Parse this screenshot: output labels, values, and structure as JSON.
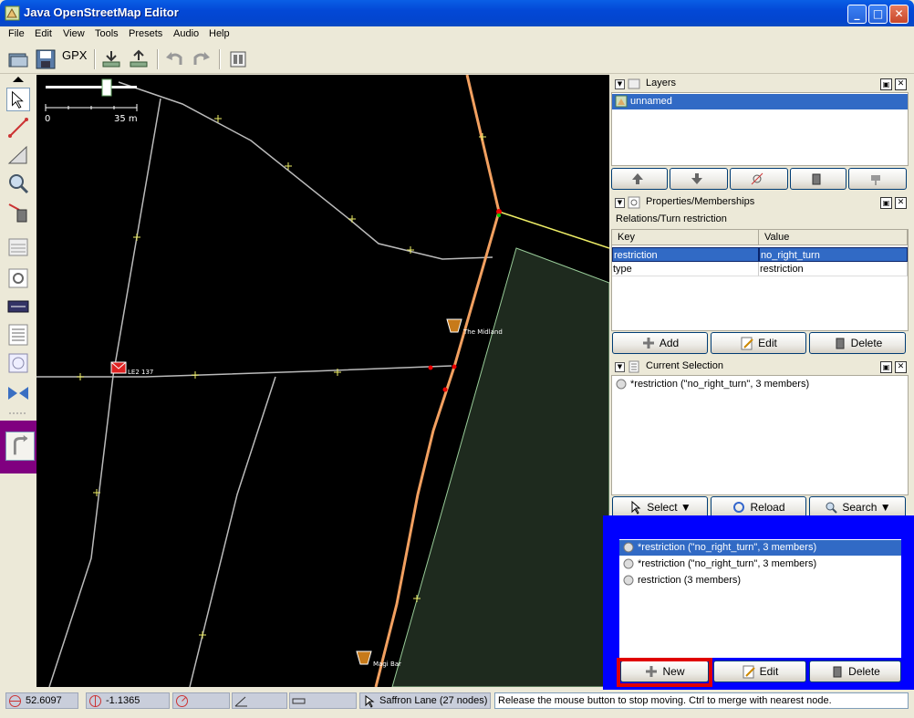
{
  "window": {
    "title": "Java OpenStreetMap Editor"
  },
  "menu": [
    "File",
    "Edit",
    "View",
    "Tools",
    "Presets",
    "Audio",
    "Help"
  ],
  "toolbar": {
    "gpx_label": "GPX"
  },
  "map": {
    "scale_min": "0",
    "scale_max": "35 m",
    "labels": {
      "postbox": "LE2 137",
      "pub1": "The Midland",
      "pub2": "Magi Bar"
    }
  },
  "layers": {
    "title": "Layers",
    "items": [
      {
        "label": "unnamed",
        "selected": true
      }
    ]
  },
  "properties": {
    "title": "Properties/Memberships",
    "subtitle": "Relations/Turn restriction",
    "columns": [
      "Key",
      "Value"
    ],
    "rows": [
      {
        "key": "restriction",
        "value": "no_right_turn",
        "selected": true
      },
      {
        "key": "type",
        "value": "restriction",
        "selected": false
      }
    ],
    "buttons": {
      "add": "Add",
      "edit": "Edit",
      "delete": "Delete"
    }
  },
  "selection": {
    "title": "Current Selection",
    "items": [
      "*restriction (\"no_right_turn\", 3 members)"
    ],
    "buttons": {
      "select": "Select",
      "reload": "Reload",
      "search": "Search"
    }
  },
  "relations": {
    "items": [
      {
        "label": "*restriction (\"no_right_turn\", 3 members)",
        "selected": true
      },
      {
        "label": "*restriction (\"no_right_turn\", 3 members)",
        "selected": false
      },
      {
        "label": "restriction (3 members)",
        "selected": false
      }
    ],
    "buttons": {
      "new": "New",
      "edit": "Edit",
      "delete": "Delete"
    }
  },
  "status": {
    "lat": "52.6097",
    "lon": "-1.1365",
    "way": "Saffron Lane (27 nodes)",
    "message": "Release the mouse button to stop moving. Ctrl to merge with nearest node."
  },
  "colors": {
    "selection": "#316AC5",
    "highlight_blue": "#0000FF",
    "highlight_red": "#E00000",
    "plugin_purple": "#800080"
  }
}
